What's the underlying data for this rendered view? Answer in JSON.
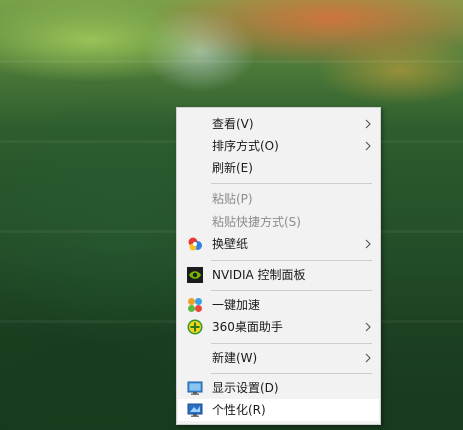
{
  "colors": {
    "menu_background": "#f2f2f2",
    "text": "#1a1a1a",
    "disabled_text": "#8c8c8c",
    "separator": "#cdcdcd",
    "hover_background": "#ffffff"
  },
  "context_menu": {
    "items": [
      {
        "label": "查看(V)",
        "submenu": true,
        "enabled": true
      },
      {
        "label": "排序方式(O)",
        "submenu": true,
        "enabled": true
      },
      {
        "label": "刷新(E)",
        "enabled": true
      },
      {
        "label": "粘贴(P)",
        "enabled": false
      },
      {
        "label": "粘贴快捷方式(S)",
        "enabled": false
      },
      {
        "label": "换壁纸",
        "submenu": true,
        "enabled": true,
        "icon": "wallpaper-icon"
      },
      {
        "label": "NVIDIA 控制面板",
        "enabled": true,
        "icon": "nvidia-icon"
      },
      {
        "label": "一键加速",
        "enabled": true,
        "icon": "accelerate-icon"
      },
      {
        "label": "360桌面助手",
        "submenu": true,
        "enabled": true,
        "icon": "360-desktop-icon"
      },
      {
        "label": "新建(W)",
        "submenu": true,
        "enabled": true
      },
      {
        "label": "显示设置(D)",
        "enabled": true,
        "icon": "display-settings-icon"
      },
      {
        "label": "个性化(R)",
        "enabled": true,
        "icon": "personalize-icon",
        "highlighted": true
      }
    ]
  }
}
